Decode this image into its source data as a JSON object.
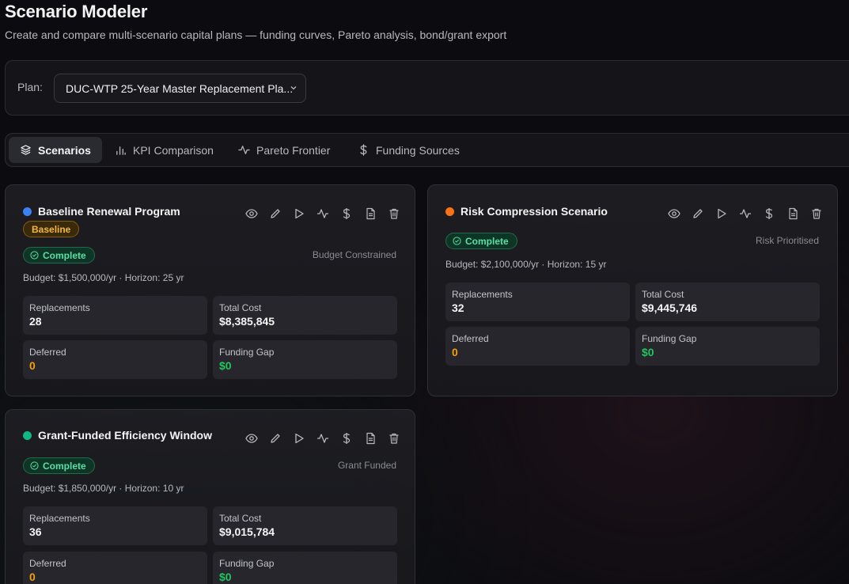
{
  "header": {
    "title": "Scenario Modeler",
    "subtitle": "Create and compare multi-scenario capital plans — funding curves, Pareto analysis, bond/grant export"
  },
  "plan": {
    "label": "Plan:",
    "selected": "DUC-WTP 25-Year Master Replacement Pla..."
  },
  "tabs": [
    {
      "label": "Scenarios",
      "icon": "layers-icon",
      "active": true
    },
    {
      "label": "KPI Comparison",
      "icon": "bar-chart-icon"
    },
    {
      "label": "Pareto Frontier",
      "icon": "activity-icon"
    },
    {
      "label": "Funding Sources",
      "icon": "dollar-icon"
    }
  ],
  "scenarios": [
    {
      "name": "Baseline Renewal Program",
      "color": "#3b82f6",
      "badge": "Baseline",
      "status": "Complete",
      "strategy": "Budget Constrained",
      "budget": "Budget: $1,500,000/yr · Horizon: 25 yr",
      "metrics": {
        "replacements_label": "Replacements",
        "replacements": "28",
        "total_cost_label": "Total Cost",
        "total_cost": "$8,385,845",
        "deferred_label": "Deferred",
        "deferred": "0",
        "funding_gap_label": "Funding Gap",
        "funding_gap": "$0"
      }
    },
    {
      "name": "Risk Compression Scenario",
      "color": "#f97316",
      "status": "Complete",
      "strategy": "Risk Prioritised",
      "budget": "Budget: $2,100,000/yr · Horizon: 15 yr",
      "metrics": {
        "replacements_label": "Replacements",
        "replacements": "32",
        "total_cost_label": "Total Cost",
        "total_cost": "$9,445,746",
        "deferred_label": "Deferred",
        "deferred": "0",
        "funding_gap_label": "Funding Gap",
        "funding_gap": "$0"
      }
    },
    {
      "name": "Grant-Funded Efficiency Window",
      "color": "#10b981",
      "status": "Complete",
      "strategy": "Grant Funded",
      "budget": "Budget: $1,850,000/yr · Horizon: 10 yr",
      "metrics": {
        "replacements_label": "Replacements",
        "replacements": "36",
        "total_cost_label": "Total Cost",
        "total_cost": "$9,015,784",
        "deferred_label": "Deferred",
        "deferred": "0",
        "funding_gap_label": "Funding Gap",
        "funding_gap": "$0"
      }
    }
  ],
  "card_actions": [
    "eye-icon",
    "pencil-icon",
    "play-icon",
    "activity-icon",
    "dollar-icon",
    "file-icon",
    "trash-icon"
  ],
  "colors": {
    "accent_green": "#22c55e",
    "accent_orange": "#f59e0b",
    "baseline_badge": "#f5b73b"
  }
}
